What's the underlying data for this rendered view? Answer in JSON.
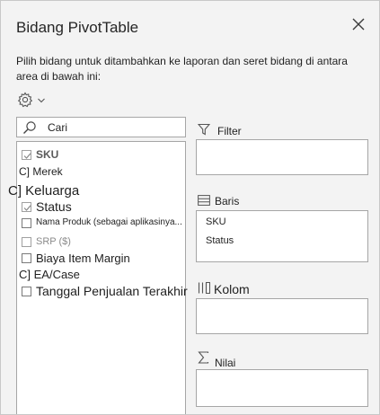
{
  "panel": {
    "title": "Bidang PivotTable",
    "description": "Pilih bidang untuk ditambahkan ke laporan dan seret bidang di antara area di bawah ini:"
  },
  "search": {
    "placeholder": "Cari"
  },
  "fields": [
    {
      "label": "SKU",
      "checked": true
    },
    {
      "label": "C] Merek"
    },
    {
      "label": "C] Keluarga"
    },
    {
      "label": "Status",
      "checked": true
    },
    {
      "label": "Nama Produk (sebagai aplikasinya...",
      "checked": false
    },
    {
      "label": "SRP ($)",
      "checked": false
    },
    {
      "label": "Biaya Item Margin",
      "checked": false
    },
    {
      "label": "C] EA/Case"
    },
    {
      "label": "Tanggal Penjualan Terakhir",
      "checked": false
    }
  ],
  "areas": {
    "filter_label": "Filter",
    "rows_label": "Baris",
    "rows_items": [
      "SKU",
      "Status"
    ],
    "columns_label": "Kolom",
    "values_label": "Nilai"
  },
  "icons": {
    "close": "close-icon",
    "settings": "gear-icon",
    "dropdown": "chevron-down-icon",
    "search": "search-icon",
    "filter": "filter-icon",
    "rows": "rows-icon",
    "columns": "columns-icon",
    "values": "sigma-icon"
  },
  "colors": {
    "panel_bg": "#f3f3f3",
    "box_border": "#a6a6a6",
    "text": "#1f1f1f"
  }
}
